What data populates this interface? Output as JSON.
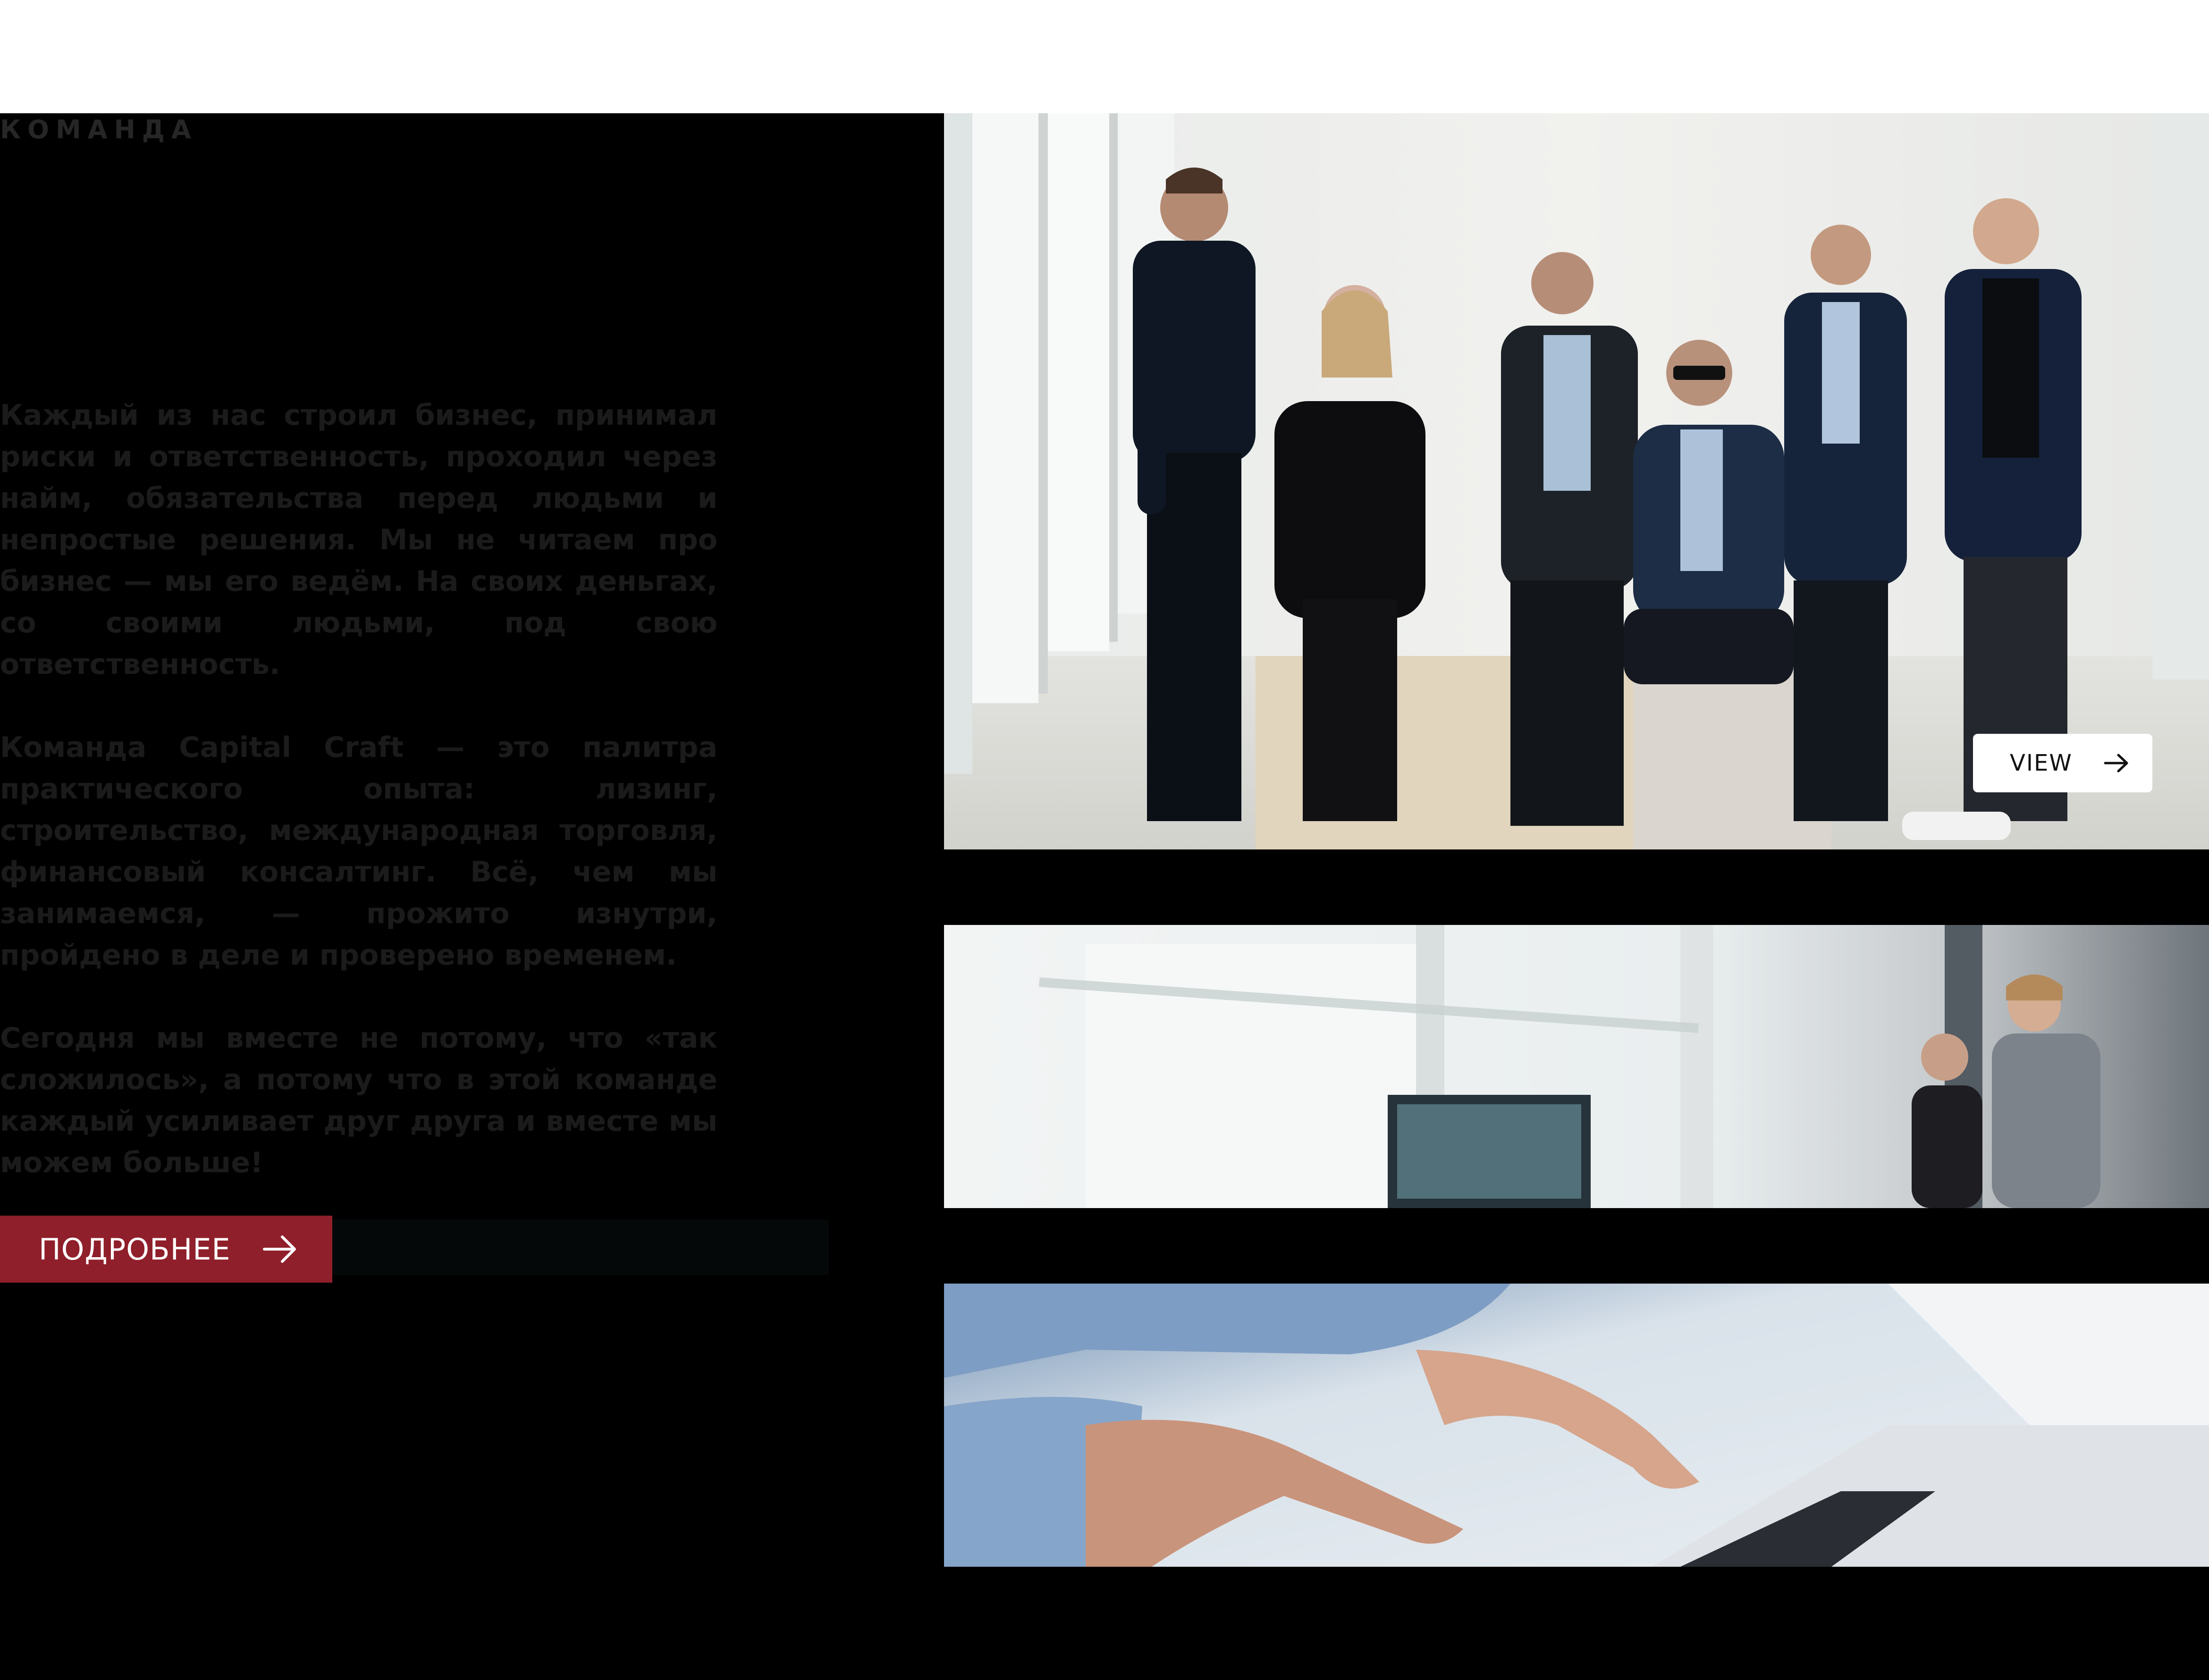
{
  "header": {},
  "section": {
    "label": "КОМАНДА"
  },
  "intro": {
    "paragraphs": [
      "Каждый из нас строил бизнес, принимал риски и ответственность, проходил через найм, обязательства перед людьми и непростые решения. Мы не читаем про бизнес — мы его ведём. На своих деньгах, со своими людьми, под свою ответственность.",
      "Команда Capital Craft — это палитра практического опыта: лизинг, строительство, международная торговля, финансовый консалтинг. Всё, чем мы занимаемся, — прожито изнутри, пройдено в деле и проверено временем.",
      "Сегодня мы вместе не потому, что «так сложилось», а потому что в этой команде каждый усиливает друг друга и вместе мы можем больше!"
    ]
  },
  "cta": {
    "label": "ПОДРОБНЕЕ",
    "icon": "arrow-right-icon"
  },
  "gallery": {
    "team_photo": {
      "view_label": "VIEW",
      "view_icon": "arrow-right-icon"
    }
  },
  "colors": {
    "background": "#000000",
    "accent": "#8f1f2a",
    "text": "#1b1b1b",
    "topbar": "#ffffff"
  }
}
